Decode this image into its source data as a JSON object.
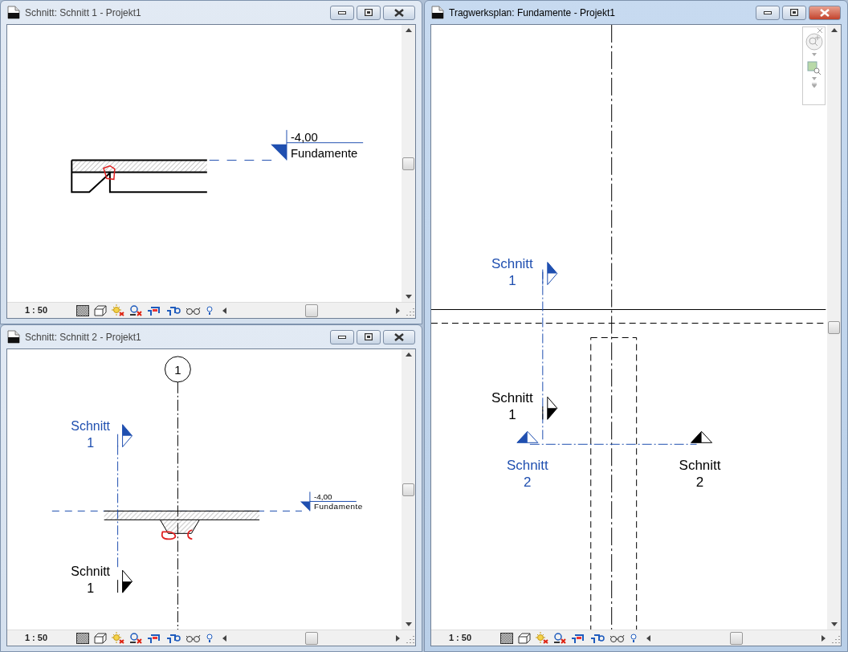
{
  "windows": [
    {
      "title": "Schnitt: Schnitt 1 - Projekt1",
      "active": false,
      "scale": "1 : 50",
      "view": {
        "kind": "section-a",
        "level": {
          "elevation": "-4,00",
          "name": "Fundamente"
        }
      }
    },
    {
      "title": "Schnitt: Schnitt 2 - Projekt1",
      "active": false,
      "scale": "1 : 50",
      "view": {
        "kind": "section-b",
        "grid_bubble": "1",
        "level": {
          "elevation": "-4,00",
          "name": "Fundamente"
        },
        "section_marks": [
          {
            "name": "Schnitt",
            "number": "1",
            "highlighted": true
          },
          {
            "name": "Schnitt",
            "number": "1",
            "highlighted": false
          }
        ]
      }
    },
    {
      "title": "Tragwerksplan: Fundamente - Projekt1",
      "active": true,
      "scale": "1 : 50",
      "view": {
        "kind": "plan",
        "section_marks": [
          {
            "name": "Schnitt",
            "number": "1",
            "highlighted": true
          },
          {
            "name": "Schnitt",
            "number": "1",
            "highlighted": false
          },
          {
            "name": "Schnitt",
            "number": "2",
            "highlighted": true
          },
          {
            "name": "Schnitt",
            "number": "2",
            "highlighted": false
          }
        ]
      }
    }
  ]
}
